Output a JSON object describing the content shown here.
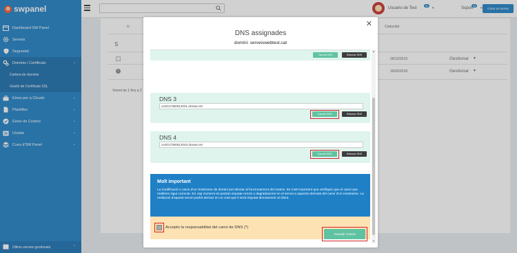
{
  "brand": {
    "name": "swpanel"
  },
  "sidebar": {
    "items": [
      {
        "label": "Dashboard SW Panel",
        "icon": "dashboard-icon",
        "chevron": false
      },
      {
        "label": "Serveis",
        "icon": "gear-icon",
        "chevron": false
      },
      {
        "label": "Seguretat",
        "icon": "shield-icon",
        "chevron": false
      },
      {
        "label": "Dominis i Certificats",
        "icon": "gears-icon",
        "chevron": true,
        "active": true
      },
      {
        "label": "Eines per a Clouds",
        "icon": "toolbox-icon",
        "chevron": true
      },
      {
        "label": "Plantilles",
        "icon": "file-icon",
        "chevron": true
      },
      {
        "label": "Eines de Control",
        "icon": "check-circle-icon",
        "chevron": true
      },
      {
        "label": "Llistats",
        "icon": "list-icon",
        "chevron": true
      },
      {
        "label": "Cues d'SW Panel",
        "icon": "layers-icon",
        "chevron": true
      }
    ],
    "subitems": [
      "Cartera de dominis",
      "Gestió de Certificats SSL"
    ],
    "bottom": {
      "label": "Últims serveis gestionats",
      "icon": "history-icon"
    }
  },
  "topbar": {
    "user": {
      "name": "Usuario de Test",
      "badge": "99"
    },
    "support": {
      "label": "Suport",
      "badge": "99"
    },
    "new_service": "Crear un servei"
  },
  "background": {
    "col_u": "U",
    "col_caducitat": "Caducitat",
    "col_s": "S",
    "rows": [
      {
        "date": "26/12/2019",
        "action": "Gestionar"
      },
      {
        "date": "16/03/2018",
        "action": "Gestionar"
      }
    ],
    "pagination": "Veient de 1 fins a 2"
  },
  "modal": {
    "title": "DNS assignades",
    "subtitle": "domini: serveiswebtest.cat",
    "change_label": "Canviar DNS",
    "delete_label": "Esborrar DNS",
    "dns": [
      {
        "title": "DNS 3",
        "value": "ce2017050812001.dnssw.net"
      },
      {
        "title": "DNS 4",
        "value": "ce2017050812002.dnssw.net"
      }
    ],
    "warning": {
      "title": "Molt important",
      "body": "La modificació o canvi d'un Hostname de domini pot afectar al funcionament del mateix. Es molt important que verifiquis que el canvi que realitzes sigui correcte. En cap moment es podran imputar errors o degradacions en el servei a aquests derivats del canvi d'un Hostname. La restitució d'aquest servei podrà derivar en un cost que li serà imputat directament al client."
    },
    "accept_label": "Accepto la responsabilitat del canvi de DNS (*)",
    "save_label": "Guardar Canvis"
  },
  "colors": {
    "primary": "#1f80c6",
    "success": "#5fc2a0",
    "highlight": "#d32226",
    "warning_bg": "#fde2b4"
  }
}
